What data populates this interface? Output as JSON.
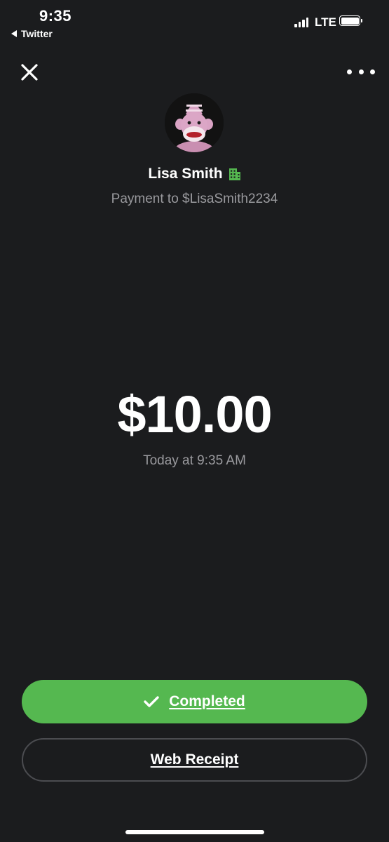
{
  "status_bar": {
    "time": "9:35",
    "back_app": "Twitter",
    "network": "LTE",
    "signal_bars": 4,
    "battery_level": 1.0
  },
  "header": {
    "close_icon": "close-icon",
    "more_icon": "more-horizontal-icon"
  },
  "recipient": {
    "name": "Lisa Smith",
    "badge_icon": "business-building-icon",
    "subtitle": "Payment to $LisaSmith2234",
    "avatar_icon": "sock-monkey-avatar"
  },
  "payment": {
    "amount": "$10.00",
    "date": "Today at 9:35 AM"
  },
  "actions": {
    "completed_label": "Completed",
    "completed_icon": "checkmark-icon",
    "receipt_label": "Web Receipt"
  },
  "colors": {
    "background": "#1b1c1e",
    "accent_green": "#55b850",
    "secondary_text": "#9a9a9e",
    "outline": "#4b4c50"
  }
}
